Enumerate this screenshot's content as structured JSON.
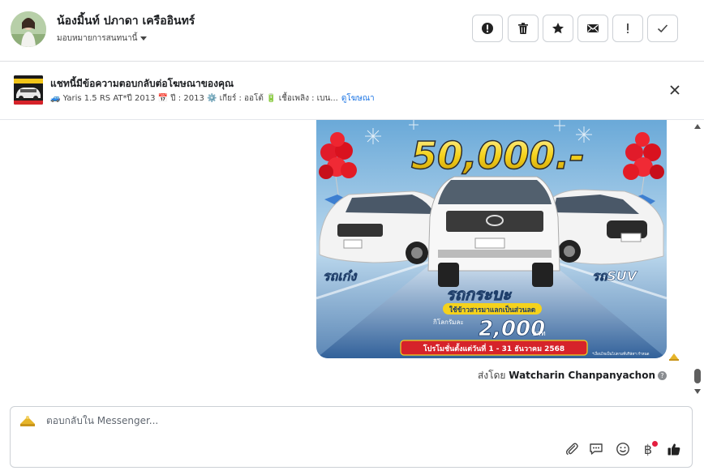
{
  "header": {
    "name": "น้องมิ้นท์ ปภาดา เครืออินทร์",
    "assign_label": "มอบหมายการสนทนานี้",
    "actions": [
      {
        "id": "report",
        "icon": "alert-circle-icon"
      },
      {
        "id": "delete",
        "icon": "trash-icon"
      },
      {
        "id": "star",
        "icon": "star-icon"
      },
      {
        "id": "mark-unread",
        "icon": "envelope-icon"
      },
      {
        "id": "important",
        "icon": "exclamation-icon"
      },
      {
        "id": "done",
        "icon": "check-icon"
      }
    ]
  },
  "ad_banner": {
    "title": "แชทนี้มีข้อความตอบกลับต่อโฆษณาของคุณ",
    "details": "🚙 Yaris 1.5 RS AT*ปี 2013 📅 ปี : 2013 ⚙️ เกียร์ : ออโต้ 🔋 เชื้อเพลิง : เบน...",
    "see_ad": "ดูโฆษณา"
  },
  "message": {
    "image": {
      "price": "50,000.-",
      "left_label": "รถเก๋ง",
      "center_label": "รถกระบะ",
      "right_label": "รถSUV",
      "promo_line": "ใช้ข้าวสารมาแลกเป็นส่วนลด",
      "per_kg": "กิโลกรัมละ",
      "amount": "2,000",
      "unit": "บาท",
      "period": "โปรโมชั่นตั้งแต่วันที่ 1 - 31 ธันวาคม 2568",
      "footnote": "*เงื่อนไขเป็นไปตามที่บริษัทฯ กำหนด"
    },
    "sent_by_prefix": "ส่งโดย",
    "sender": "Watcharin Chanpanyachon"
  },
  "composer": {
    "placeholder": "ตอบกลับใน Messenger...",
    "baht_symbol": "฿",
    "tools": [
      "attachment-icon",
      "saved-reply-icon",
      "emoji-icon",
      "payment-icon",
      "like-icon"
    ]
  },
  "colors": {
    "accent": "#1b74e4",
    "border": "#ccd0d5",
    "banner_red": "#d6232a",
    "price_yellow": "#f5d21c"
  }
}
